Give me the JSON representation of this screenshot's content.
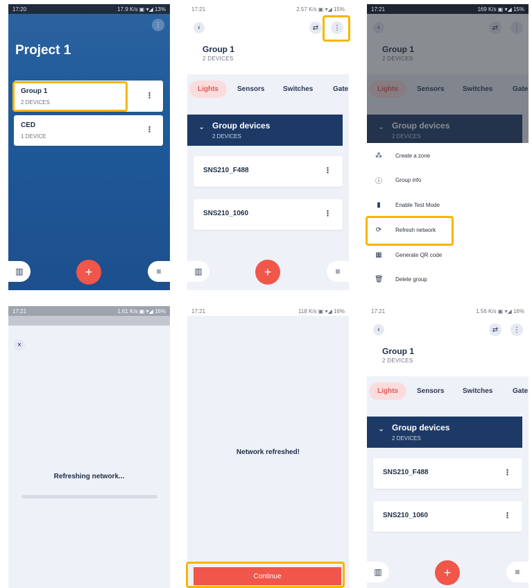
{
  "s1": {
    "status": {
      "time": "17:20",
      "network": "17.9 K/s",
      "battery": "13%"
    },
    "project_title": "Project 1",
    "groups": [
      {
        "name": "Group 1",
        "count": "2 DEVICES"
      },
      {
        "name": "CED",
        "count": "1 DEVICE"
      }
    ]
  },
  "s2": {
    "status": {
      "time": "17:21",
      "network": "2.57 K/s",
      "battery": "15%"
    },
    "group_title": "Group 1",
    "group_count": "2 DEVICES",
    "tabs": [
      "Lights",
      "Sensors",
      "Switches",
      "Gate"
    ],
    "section_title": "Group devices",
    "section_count": "2 DEVICES",
    "devices": [
      "SNS210_F488",
      "SNS210_1060"
    ]
  },
  "s3": {
    "status": {
      "time": "17:21",
      "network": "169 K/s",
      "battery": "15%"
    },
    "menu": [
      {
        "label": "Create a zone",
        "icon": "zone-icon"
      },
      {
        "label": "Group info",
        "icon": "info-icon"
      },
      {
        "label": "Enable Test Mode",
        "icon": "sim-icon"
      },
      {
        "label": "Refresh network",
        "icon": "refresh-icon"
      },
      {
        "label": "Generate QR code",
        "icon": "qr-icon"
      },
      {
        "label": "Delete group",
        "icon": "trash-icon"
      }
    ]
  },
  "s4": {
    "status": {
      "time": "17:21",
      "network": "1.61 K/s",
      "battery": "16%"
    },
    "message": "Refreshing network..."
  },
  "s5": {
    "status": {
      "time": "17:21",
      "network": "118 K/s",
      "battery": "16%"
    },
    "message": "Network refreshed!",
    "continue_label": "Continue"
  },
  "s6": {
    "status": {
      "time": "17:21",
      "network": "1.56 K/s",
      "battery": "16%"
    }
  },
  "colors": {
    "brand_blue": "#1d3a66",
    "accent_red": "#f0564a",
    "highlight": "#f7b500"
  }
}
